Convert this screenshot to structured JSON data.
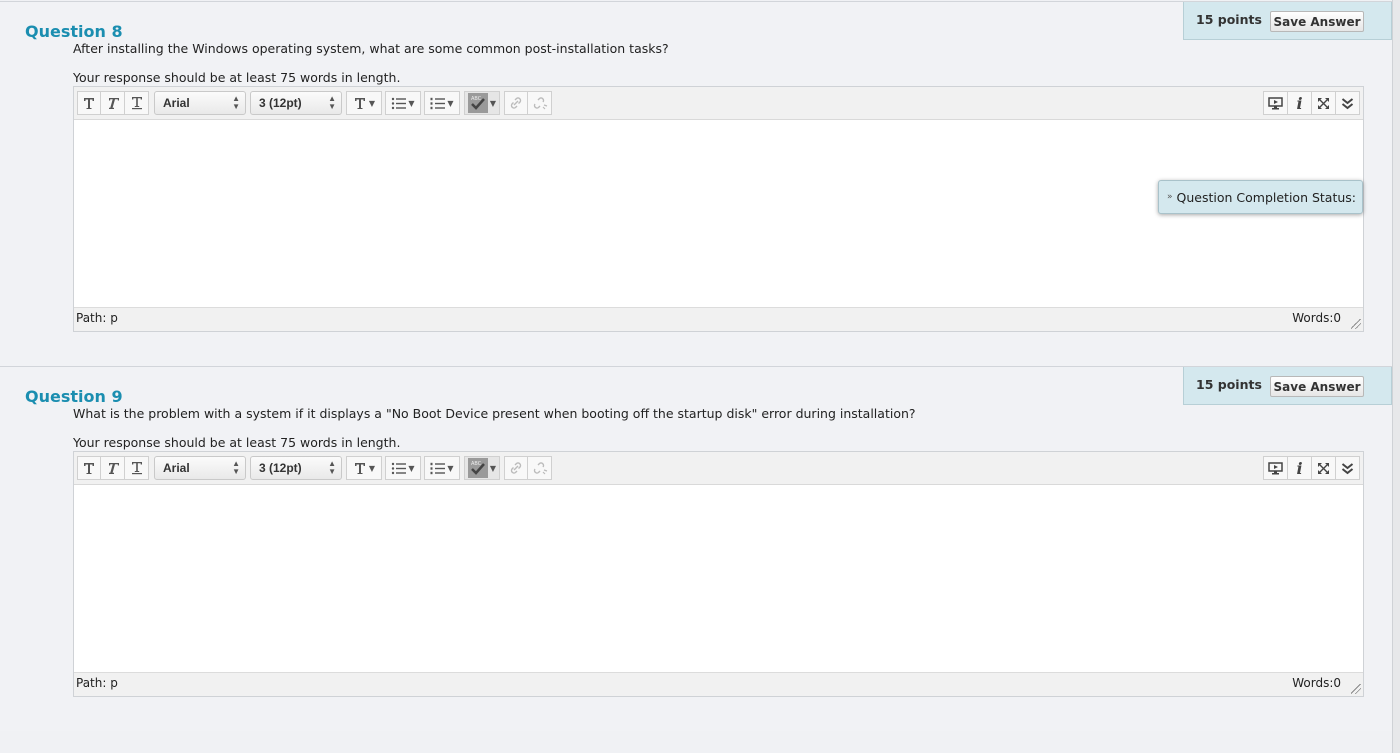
{
  "questions": [
    {
      "title": "Question 8",
      "text": "After installing the Windows operating system, what are some common post-installation tasks?",
      "instruction": "Your response should be at least 75 words in length.",
      "points": "15 points",
      "save_label": "Save Answer",
      "editor": {
        "font_family": "Arial",
        "font_size": "3 (12pt)",
        "path_label": "Path:",
        "path_value": "p",
        "words_label": "Words:0"
      }
    },
    {
      "title": "Question 9",
      "text": "What is the problem with a system if it displays a \"No Boot Device present when booting off the startup disk\" error during installation?",
      "instruction": "Your response should be at least 75 words in length.",
      "points": "15 points",
      "save_label": "Save Answer",
      "editor": {
        "font_family": "Arial",
        "font_size": "3 (12pt)",
        "path_label": "Path:",
        "path_value": "p",
        "words_label": "Words:0"
      }
    }
  ],
  "completion_status": {
    "label": "Question Completion Status:",
    "icon": "chevron-double-down-icon"
  },
  "toolbar_icons": [
    "bold-icon",
    "italic-icon",
    "underline-icon",
    "text-color-icon",
    "bullet-list-icon",
    "numbered-list-icon",
    "spellcheck-icon",
    "link-icon",
    "unlink-icon",
    "preview-icon",
    "info-icon",
    "fullscreen-icon",
    "expand-toolbar-icon"
  ],
  "colors": {
    "accent": "#1b8eb0",
    "panel": "#d4e8ee",
    "page_bg": "#f1f2f5"
  }
}
